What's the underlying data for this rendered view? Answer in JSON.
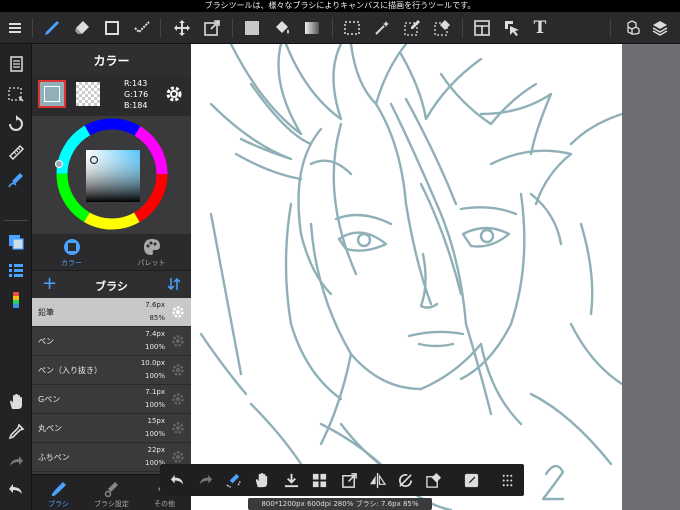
{
  "status_bar": {
    "text": "ブラシツールは、様々なブラシによりキャンバスに描画を行うツールです。"
  },
  "top_toolbar": {
    "text_tool_label": "T"
  },
  "color_panel": {
    "title": "カラー",
    "rgb": {
      "r": "R:143",
      "g": "G:176",
      "b": "B:184"
    },
    "colors": {
      "main": "#8fb0b8",
      "accent": "#4aa3ff"
    },
    "tabs": [
      {
        "label": "カラー"
      },
      {
        "label": "パレット"
      }
    ]
  },
  "brush_panel": {
    "title": "ブラシ",
    "add_label": "+",
    "items": [
      {
        "name": "鉛筆",
        "size": "7.6px",
        "opacity": "85%"
      },
      {
        "name": "ペン",
        "size": "7.4px",
        "opacity": "100%"
      },
      {
        "name": "ペン（入り抜き）",
        "size": "10.0px",
        "opacity": "100%"
      },
      {
        "name": "Gペン",
        "size": "7.1px",
        "opacity": "100%"
      },
      {
        "name": "丸ペン",
        "size": "15px",
        "opacity": "100%"
      },
      {
        "name": "ふちペン",
        "size": "22px",
        "opacity": "100%"
      }
    ],
    "bottom_tabs": [
      {
        "label": "ブラシ"
      },
      {
        "label": "ブラシ設定"
      },
      {
        "label": "その他"
      }
    ]
  },
  "info_bar": {
    "text": "800*1200px 600dpi 280% ブラシ: 7.6px 85%"
  }
}
